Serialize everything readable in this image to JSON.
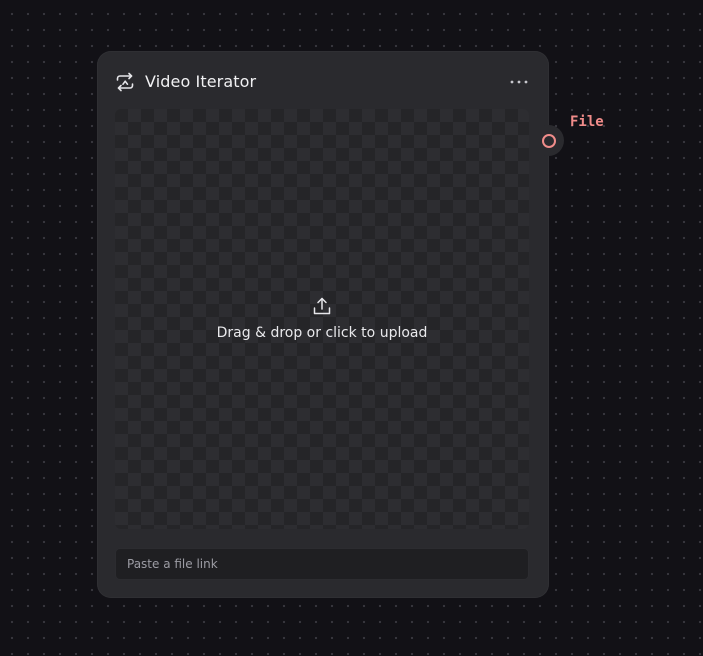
{
  "node": {
    "title": "Video Iterator",
    "title_icon": "loop-arrows-icon",
    "menu_icon": "more-horizontal-icon"
  },
  "upload": {
    "icon": "upload-icon",
    "text": "Drag & drop or click to upload"
  },
  "link_input": {
    "value": "",
    "placeholder": "Paste a file link"
  },
  "output_port": {
    "label": "File",
    "color": "#f08c8a"
  },
  "colors": {
    "canvas_background": "#121116",
    "node_background": "#2a2a2e",
    "accent": "#f08c8a"
  }
}
